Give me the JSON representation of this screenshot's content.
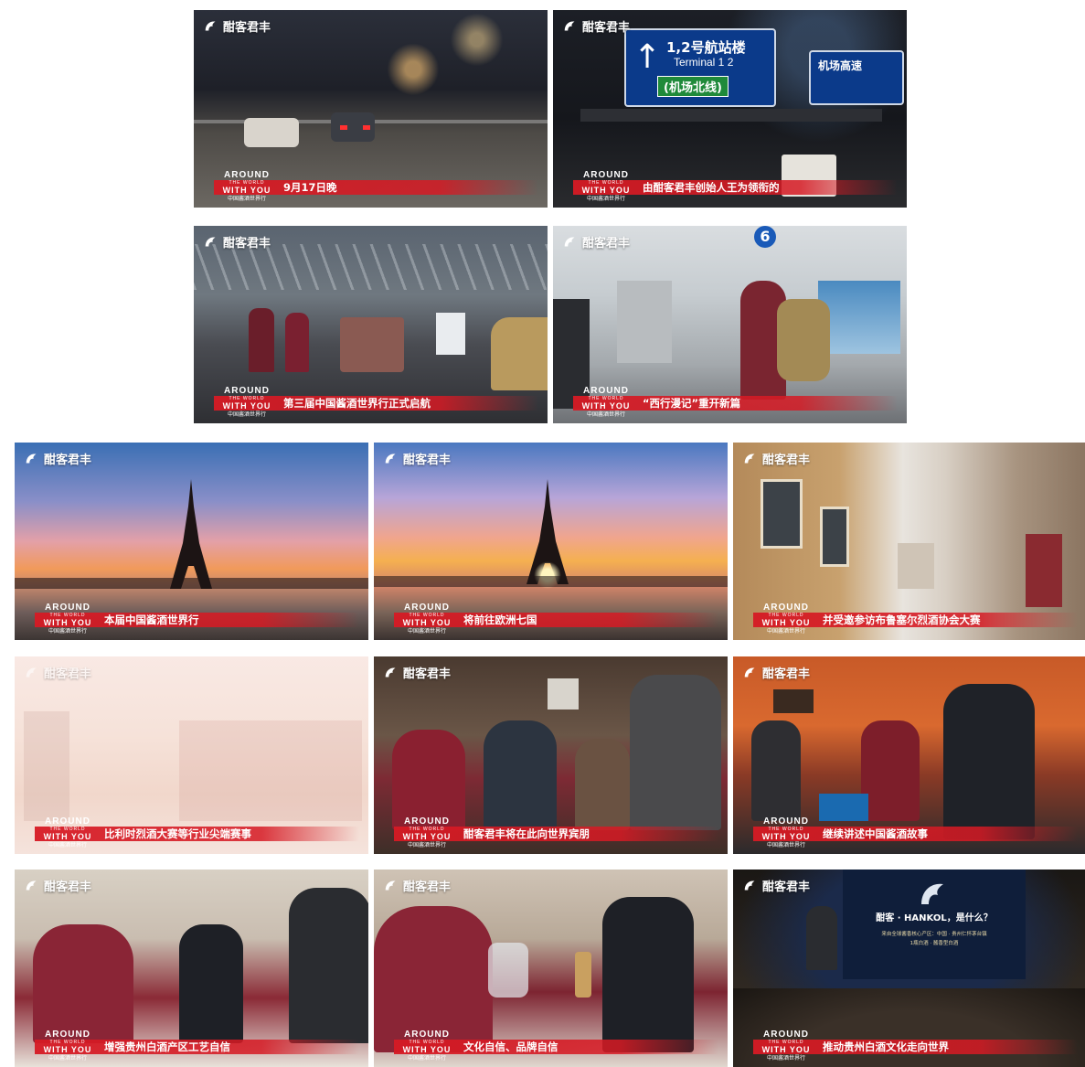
{
  "logo_text": "酣客君丰",
  "brand": {
    "around": "AROUND",
    "the_world": "THE WORLD",
    "with_you": "WITH YOU",
    "cn": "中国酱酒世界行"
  },
  "colors": {
    "caption_red": "#d61a24",
    "text": "#ffffff"
  },
  "frames": [
    {
      "caption": "9月17日晚",
      "scene": "highway"
    },
    {
      "caption": "由酣客君丰创始人王为领衔的",
      "scene": "airport-sign",
      "sign_main": "1,2号航站楼",
      "sign_en": "Terminal 1 2",
      "sign_sub": "(机场北线)",
      "sign_right": "机场高速"
    },
    {
      "caption": "第三届中国酱酒世界行正式启航",
      "scene": "terminal-canopy"
    },
    {
      "caption": "“西行漫记”重开新篇",
      "scene": "terminal-interior"
    },
    {
      "caption": "本届中国酱酒世界行",
      "scene": "eiffel-sunset"
    },
    {
      "caption": "将前往欧洲七国",
      "scene": "eiffel-sunrise"
    },
    {
      "caption": "并受邀参访布鲁塞尔烈酒协会大赛",
      "scene": "old-street"
    },
    {
      "caption": "比利时烈酒大赛等行业尖端赛事",
      "scene": "faded-city"
    },
    {
      "caption": "酣客君丰将在此向世界宾朋",
      "scene": "bar-meeting"
    },
    {
      "caption": "继续讲述中国酱酒故事",
      "scene": "orange-bar"
    },
    {
      "caption": "增强贵州白酒产区工艺自信",
      "scene": "tasting-hall"
    },
    {
      "caption": "文化自信、品牌自信",
      "scene": "tasting-hall-2"
    },
    {
      "caption": "推动贵州白酒文化走向世界",
      "scene": "presentation",
      "screen_title": "酣客 · HANKOL，是什么？",
      "screen_line1": "来自全球酱香核心产区：中国 · 贵州仁怀茅台镇",
      "screen_line2": "1瓶白酒 · 酱香型白酒"
    }
  ]
}
